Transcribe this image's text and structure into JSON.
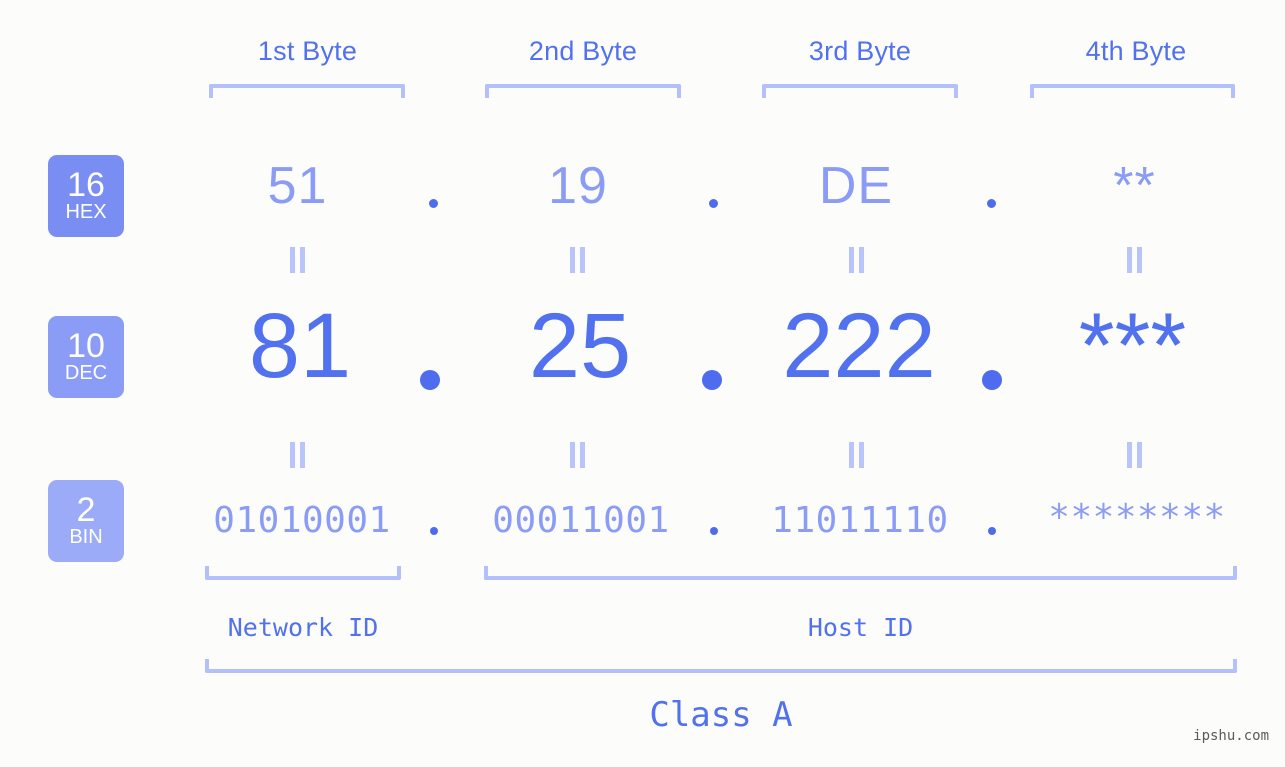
{
  "page": {
    "background_color": "#fcfdfa",
    "accent_strong": "#5271ef",
    "accent_light": "#8b9cf6",
    "accent_pale": "#b3c0fb",
    "watermark": "ipshu.com"
  },
  "byte_headers": [
    {
      "label": "1st Byte"
    },
    {
      "label": "2nd Byte"
    },
    {
      "label": "3rd Byte"
    },
    {
      "label": "4th Byte"
    }
  ],
  "rows": [
    {
      "id": "hex",
      "badge_number": "16",
      "badge_abbr": "HEX",
      "badge_color": "#7a8df3",
      "values": [
        "51",
        "19",
        "DE",
        "**"
      ],
      "separator": "."
    },
    {
      "id": "dec",
      "badge_number": "10",
      "badge_abbr": "DEC",
      "badge_color": "#8b9cf6",
      "values": [
        "81",
        "25",
        "222",
        "***"
      ],
      "separator": "."
    },
    {
      "id": "bin",
      "badge_number": "2",
      "badge_abbr": "BIN",
      "badge_color": "#9cabf8",
      "values": [
        "01010001",
        "00011001",
        "11011110",
        "********"
      ],
      "separator": "."
    }
  ],
  "equals_marks": {
    "glyph": "||",
    "count_per_gap": 4,
    "gaps": 2
  },
  "segments": {
    "network_id": "Network ID",
    "host_id": "Host ID",
    "class": "Class A"
  }
}
